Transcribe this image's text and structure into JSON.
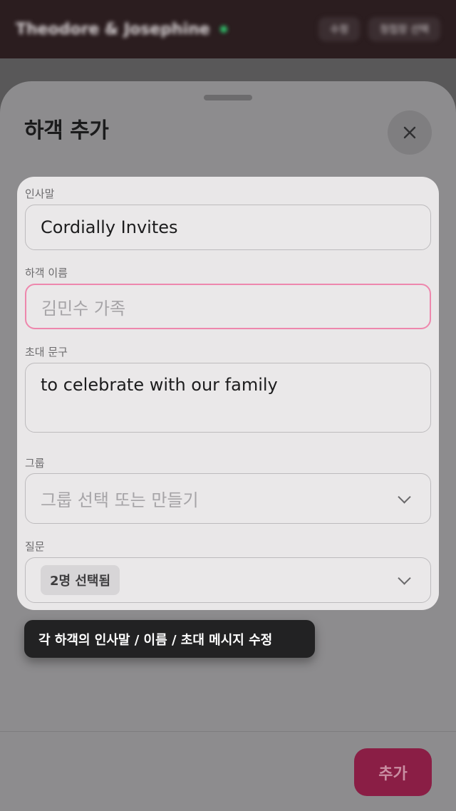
{
  "background": {
    "couple_name": "Theodore & Josephine",
    "actions": [
      "수정",
      "청첩장 선택"
    ],
    "tabs": [
      "",
      "",
      ""
    ]
  },
  "sheet": {
    "title": "하객 추가",
    "close_icon": "close-icon",
    "add_button": "추가"
  },
  "form": {
    "greeting": {
      "label": "인사말",
      "value": "Cordially Invites"
    },
    "guest_name": {
      "label": "하객 이름",
      "placeholder": "김민수 가족",
      "value": ""
    },
    "invitation_text": {
      "label": "초대 문구",
      "value": "to celebrate with our family"
    },
    "group": {
      "label": "그룹",
      "placeholder": "그룹 선택 또는 만들기"
    },
    "questions": {
      "label": "질문",
      "selected": "2명 선택됨"
    }
  },
  "tooltip": {
    "text": "각 하객의 인사말 / 이름 / 초대 메시지 수정"
  },
  "colors": {
    "accent": "#8a1e45",
    "focus_border": "#ee87ad",
    "tooltip_bg": "#222223"
  }
}
